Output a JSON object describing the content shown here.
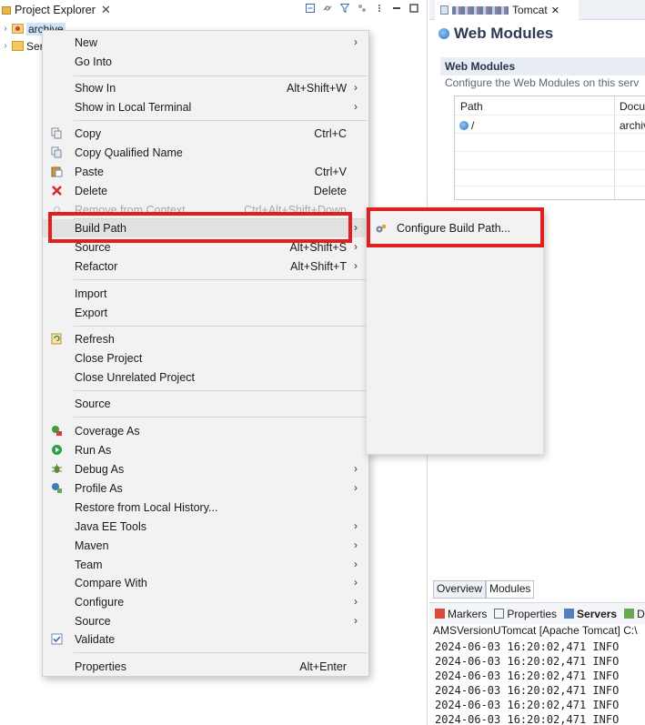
{
  "project_explorer": {
    "tab_label": "Project Explorer",
    "tab_close": "✕",
    "tree": [
      {
        "label": "archive",
        "selected": true
      },
      {
        "label": "Ser",
        "selected": false
      }
    ]
  },
  "editor": {
    "tab_label": "Tomcat",
    "tab_close": "✕",
    "heading": "Web Modules",
    "section_title": "Web Modules",
    "section_desc": "Configure the Web Modules on this serv",
    "table": {
      "columns": [
        "Path",
        "Docu"
      ],
      "rows": [
        [
          "/",
          "archiv"
        ]
      ]
    },
    "bottom_tabs": [
      "Overview",
      "Modules"
    ]
  },
  "console": {
    "tabs": [
      "Markers",
      "Properties",
      "Servers",
      "D"
    ],
    "title": "AMSVersionUTomcat [Apache Tomcat] C:\\",
    "lines": [
      "2024-06-03 16:20:02,471  INFO",
      "2024-06-03 16:20:02,471  INFO",
      "2024-06-03 16:20:02,471  INFO",
      "2024-06-03 16:20:02,471  INFO",
      "2024-06-03 16:20:02,471  INFO",
      "2024-06-03 16:20:02,471  INFO"
    ]
  },
  "context_menu": {
    "items": [
      {
        "label": "New",
        "accel": "",
        "submenu": true
      },
      {
        "label": "Go Into",
        "accel": "",
        "submenu": false
      },
      {
        "label": "Show In",
        "accel": "Alt+Shift+W",
        "submenu": true
      },
      {
        "label": "Show in Local Terminal",
        "accel": "",
        "submenu": true
      },
      {
        "label": "Copy",
        "accel": "Ctrl+C",
        "submenu": false
      },
      {
        "label": "Copy Qualified Name",
        "accel": "",
        "submenu": false
      },
      {
        "label": "Paste",
        "accel": "Ctrl+V",
        "submenu": false
      },
      {
        "label": "Delete",
        "accel": "Delete",
        "submenu": false
      },
      {
        "label": "Remove from Context",
        "accel": "Ctrl+Alt+Shift+Down",
        "submenu": false,
        "disabled": true
      },
      {
        "label": "Build Path",
        "accel": "",
        "submenu": true,
        "highlighted": true
      },
      {
        "label": "Source",
        "accel": "Alt+Shift+S",
        "submenu": true
      },
      {
        "label": "Refactor",
        "accel": "Alt+Shift+T",
        "submenu": true
      },
      {
        "label": "Import",
        "accel": "",
        "submenu": false
      },
      {
        "label": "Export",
        "accel": "",
        "submenu": false
      },
      {
        "label": "Refresh",
        "accel": "",
        "submenu": false
      },
      {
        "label": "Close Project",
        "accel": "",
        "submenu": false
      },
      {
        "label": "Close Unrelated Project",
        "accel": "",
        "submenu": false
      },
      {
        "label": "Source",
        "accel": "",
        "submenu": false
      },
      {
        "label": "Coverage As",
        "accel": "",
        "submenu": false
      },
      {
        "label": "Run As",
        "accel": "",
        "submenu": false
      },
      {
        "label": "Debug As",
        "accel": "",
        "submenu": true
      },
      {
        "label": "Profile As",
        "accel": "",
        "submenu": true
      },
      {
        "label": "Restore from Local History...",
        "accel": "",
        "submenu": false
      },
      {
        "label": "Java EE Tools",
        "accel": "",
        "submenu": true
      },
      {
        "label": "Maven",
        "accel": "",
        "submenu": true
      },
      {
        "label": "Team",
        "accel": "",
        "submenu": true
      },
      {
        "label": "Compare With",
        "accel": "",
        "submenu": true
      },
      {
        "label": "Configure",
        "accel": "",
        "submenu": true
      },
      {
        "label": "Source",
        "accel": "",
        "submenu": true
      },
      {
        "label": "Validate",
        "accel": "",
        "submenu": false,
        "checked": true
      },
      {
        "label": "Properties",
        "accel": "Alt+Enter",
        "submenu": false
      }
    ]
  },
  "submenu": {
    "items": [
      {
        "label": "Configure Build Path..."
      }
    ]
  },
  "colors": {
    "annotation_red": "#e0201f",
    "menu_bg": "#f2f2f2",
    "selection_bg": "#cde6fb"
  }
}
